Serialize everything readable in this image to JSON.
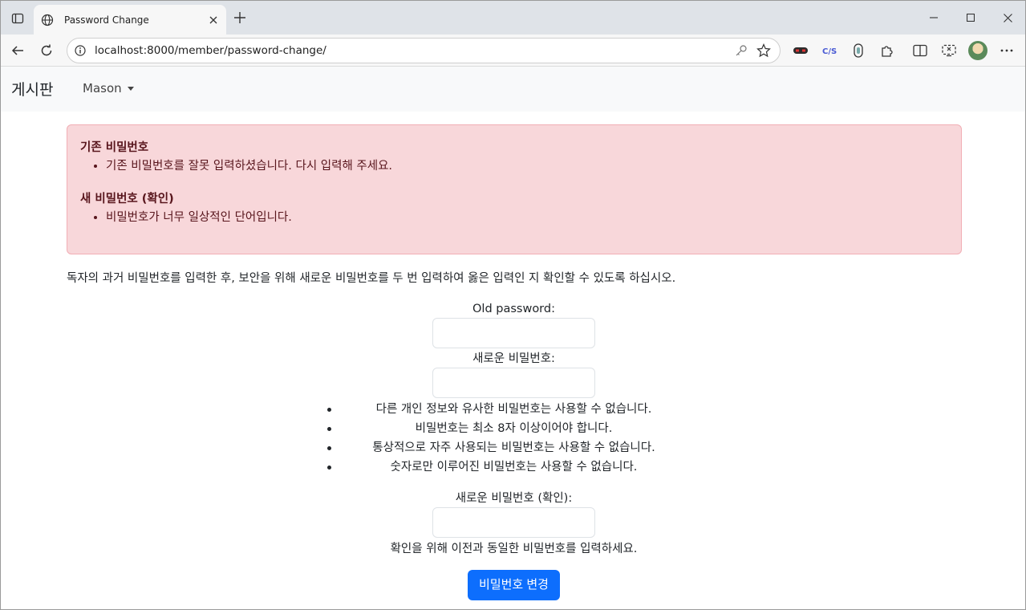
{
  "browser": {
    "tab_title": "Password Change",
    "url": "localhost:8000/member/password-change/"
  },
  "site": {
    "brand": "게시판",
    "user_menu": "Mason"
  },
  "alert": {
    "groups": [
      {
        "field": "기존 비밀번호",
        "errors": [
          "기존 비밀번호를 잘못 입력하셨습니다. 다시 입력해 주세요."
        ]
      },
      {
        "field": "새 비밀번호 (확인)",
        "errors": [
          "비밀번호가 너무 일상적인 단어입니다."
        ]
      }
    ]
  },
  "intro": "독자의 과거 비밀번호를 입력한 후, 보안을 위해 새로운 비밀번호를 두 번 입력하여 옳은 입력인 지 확인할 수 있도록 하십시오.",
  "form": {
    "old_password_label": "Old password:",
    "new_password_label": "새로운 비밀번호:",
    "help_items": [
      "다른 개인 정보와 유사한 비밀번호는 사용할 수 없습니다.",
      "비밀번호는 최소 8자 이상이어야 합니다.",
      "통상적으로 자주 사용되는 비밀번호는 사용할 수 없습니다.",
      "숫자로만 이루어진 비밀번호는 사용할 수 없습니다."
    ],
    "confirm_label": "새로운 비밀번호 (확인):",
    "confirm_hint": "확인을 위해 이전과 동일한 비밀번호를 입력하세요.",
    "submit_label": "비밀번호 변경"
  },
  "colors": {
    "primary": "#0d6efd",
    "alert_bg": "#f8d7da",
    "alert_text": "#58151c"
  }
}
